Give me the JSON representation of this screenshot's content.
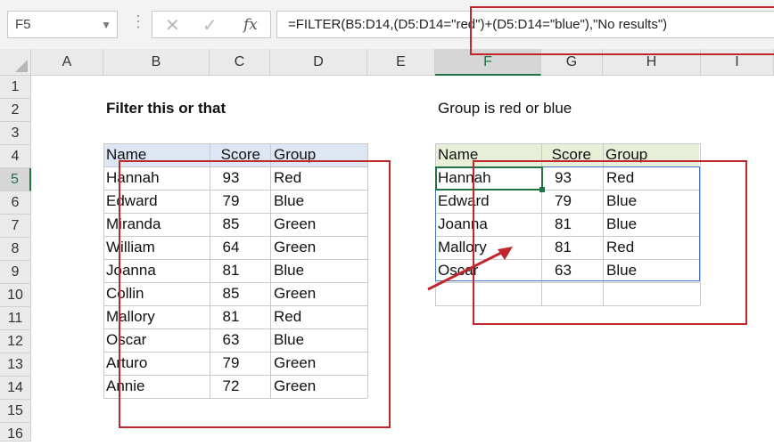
{
  "formula_bar": {
    "name_box": "F5",
    "cancel_icon": "✕",
    "enter_icon": "✓",
    "fx_label": "fx",
    "formula": "=FILTER(B5:D14,(D5:D14=\"red\")+(D5:D14=\"blue\"),\"No results\")"
  },
  "column_headers": [
    "A",
    "B",
    "C",
    "D",
    "E",
    "F",
    "G",
    "H",
    "I"
  ],
  "row_headers": [
    "1",
    "2",
    "3",
    "4",
    "5",
    "6",
    "7",
    "8",
    "9",
    "10",
    "11",
    "12",
    "13",
    "14",
    "15",
    "16"
  ],
  "left_table": {
    "title": "Filter this or that",
    "headers": [
      "Name",
      "Score",
      "Group"
    ],
    "rows": [
      [
        "Hannah",
        "93",
        "Red"
      ],
      [
        "Edward",
        "79",
        "Blue"
      ],
      [
        "Miranda",
        "85",
        "Green"
      ],
      [
        "William",
        "64",
        "Green"
      ],
      [
        "Joanna",
        "81",
        "Blue"
      ],
      [
        "Collin",
        "85",
        "Green"
      ],
      [
        "Mallory",
        "81",
        "Red"
      ],
      [
        "Oscar",
        "63",
        "Blue"
      ],
      [
        "Arturo",
        "79",
        "Green"
      ],
      [
        "Annie",
        "72",
        "Green"
      ]
    ]
  },
  "right_table": {
    "title": "Group is red or blue",
    "headers": [
      "Name",
      "Score",
      "Group"
    ],
    "rows": [
      [
        "Hannah",
        "93",
        "Red"
      ],
      [
        "Edward",
        "79",
        "Blue"
      ],
      [
        "Joanna",
        "81",
        "Blue"
      ],
      [
        "Mallory",
        "81",
        "Red"
      ],
      [
        "Oscar",
        "63",
        "Blue"
      ]
    ]
  },
  "colors": {
    "left_header_bg": "#dde7f3",
    "right_header_bg": "#e8efd9",
    "annotation_red": "#c0262b",
    "active_cell_green": "#217346",
    "spill_blue": "#4472c4"
  },
  "icons": [
    "cancel-icon",
    "enter-icon",
    "fx-icon",
    "dropdown-arrow-icon",
    "select-all-icon"
  ]
}
